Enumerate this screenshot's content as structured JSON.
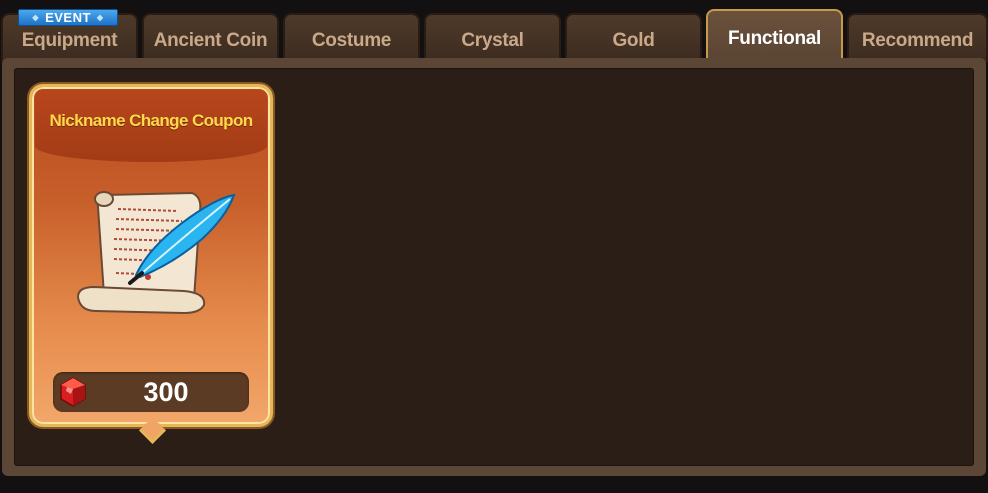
{
  "tabs": [
    {
      "label": "Equipment",
      "active": false
    },
    {
      "label": "Ancient Coin",
      "active": false
    },
    {
      "label": "Costume",
      "active": false
    },
    {
      "label": "Crystal",
      "active": false
    },
    {
      "label": "Gold",
      "active": false
    },
    {
      "label": "Functional",
      "active": true
    },
    {
      "label": "Recommend",
      "active": false
    }
  ],
  "event_badge": "EVENT",
  "product": {
    "title": "Nickname Change Coupon",
    "icon": "scroll-quill-icon",
    "currency_icon": "ruby-icon",
    "price": "300"
  },
  "colors": {
    "active_tab_border": "#c79a4a",
    "card_title": "#ffd94a",
    "event_badge": "#2f8ee0"
  }
}
